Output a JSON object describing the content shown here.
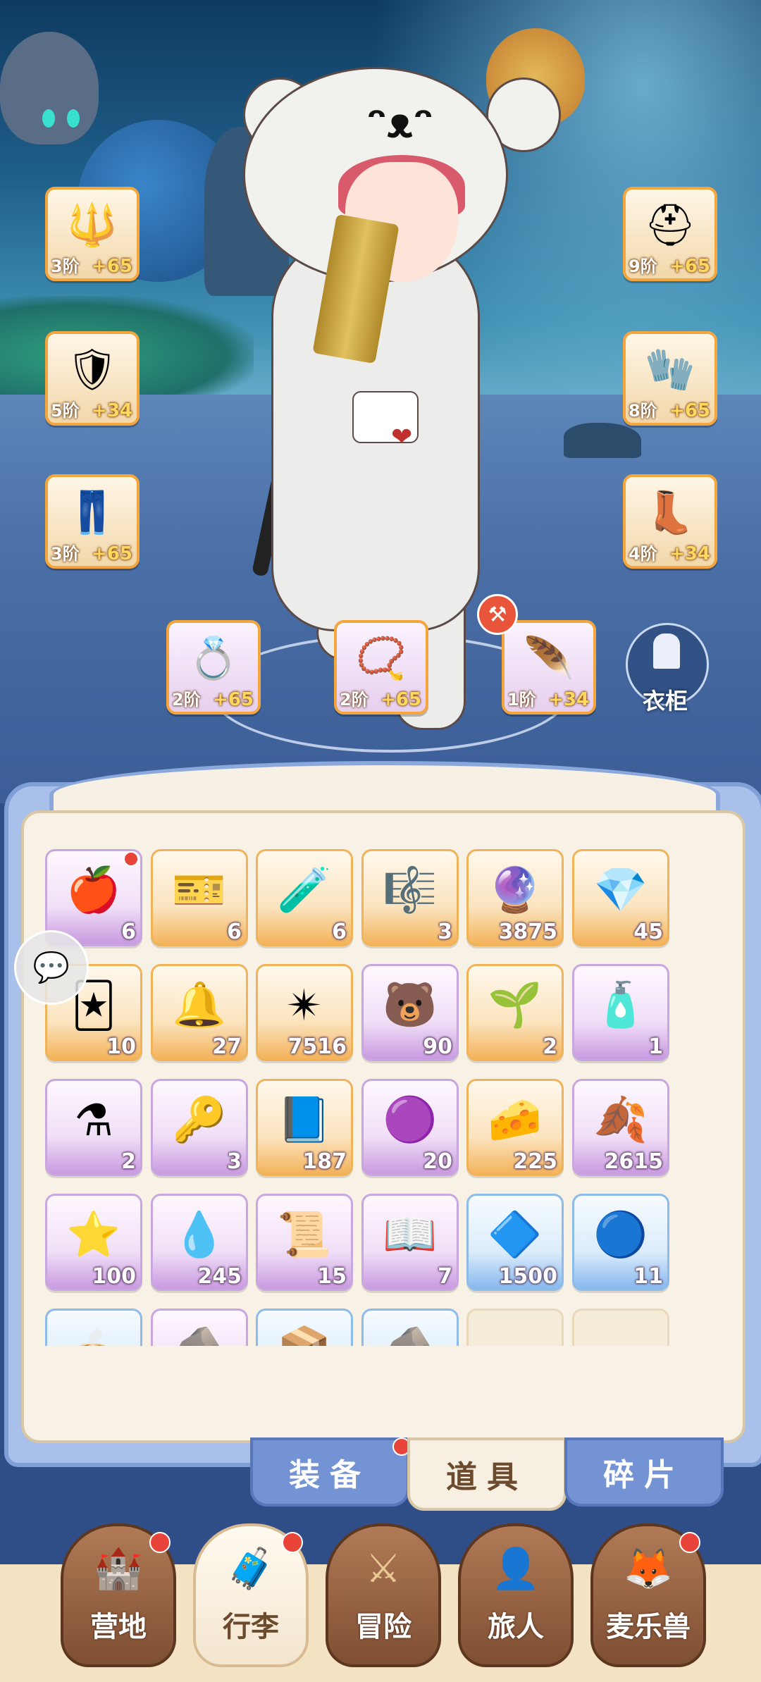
{
  "equipment": {
    "weapon": {
      "icon": "trident-weapon-icon",
      "glyph": "🔱",
      "tier": "3阶",
      "level": "+65"
    },
    "chest": {
      "icon": "armor-chest-icon",
      "glyph": "🛡",
      "tier": "5阶",
      "level": "+34"
    },
    "legs": {
      "icon": "armor-legs-icon",
      "glyph": "👖",
      "tier": "3阶",
      "level": "+65"
    },
    "helmet": {
      "icon": "winged-helmet-icon",
      "glyph": "⛑",
      "tier": "9阶",
      "level": "+65"
    },
    "gloves": {
      "icon": "gauntlet-icon",
      "glyph": "🧤",
      "tier": "8阶",
      "level": "+65"
    },
    "boots": {
      "icon": "boots-icon",
      "glyph": "👢",
      "tier": "4阶",
      "level": "+34"
    },
    "ring": {
      "icon": "ring-icon",
      "glyph": "💍",
      "tier": "2阶",
      "level": "+65"
    },
    "necklace": {
      "icon": "necklace-icon",
      "glyph": "📿",
      "tier": "2阶",
      "level": "+65"
    },
    "earring": {
      "icon": "earring-icon",
      "glyph": "🪶",
      "tier": "1阶",
      "level": "+34"
    }
  },
  "forge_badge_icon": "hammer-icon",
  "wardrobe": {
    "label": "衣柜",
    "icon": "wardrobe-icon"
  },
  "inventory": {
    "items": [
      {
        "icon": "apple-icon",
        "glyph": "🍎",
        "count": "6",
        "rarity": "purple",
        "new": true
      },
      {
        "icon": "ticket-icon",
        "glyph": "🎫",
        "count": "6",
        "rarity": "orange"
      },
      {
        "icon": "blue-potion-icon",
        "glyph": "🧪",
        "count": "6",
        "rarity": "orange"
      },
      {
        "icon": "lyre-icon",
        "glyph": "🎼",
        "count": "3",
        "rarity": "orange"
      },
      {
        "icon": "crystal-orb-icon",
        "glyph": "🔮",
        "count": "3875",
        "rarity": "orange"
      },
      {
        "icon": "ice-crystal-icon",
        "glyph": "💎",
        "count": "45",
        "rarity": "orange"
      },
      {
        "icon": "outfit-card-icon",
        "glyph": "🃏",
        "count": "10",
        "rarity": "orange"
      },
      {
        "icon": "bell-icon",
        "glyph": "🔔",
        "count": "27",
        "rarity": "orange"
      },
      {
        "icon": "star-crystal-icon",
        "glyph": "✴",
        "count": "7516",
        "rarity": "orange"
      },
      {
        "icon": "bear-badge-icon",
        "glyph": "🐻",
        "count": "90",
        "rarity": "purple"
      },
      {
        "icon": "seed-pod-icon",
        "glyph": "🌱",
        "count": "2",
        "rarity": "orange"
      },
      {
        "icon": "potion-bottle-icon",
        "glyph": "🧴",
        "count": "1",
        "rarity": "purple"
      },
      {
        "icon": "red-potion-icon",
        "glyph": "⚗",
        "count": "2",
        "rarity": "purple"
      },
      {
        "icon": "gold-key-icon",
        "glyph": "🔑",
        "count": "3",
        "rarity": "purple"
      },
      {
        "icon": "blue-card-icon",
        "glyph": "📘",
        "count": "187",
        "rarity": "orange"
      },
      {
        "icon": "cat-frame-purple-icon",
        "glyph": "🟣",
        "count": "20",
        "rarity": "purple"
      },
      {
        "icon": "cheese-icon",
        "glyph": "🧀",
        "count": "225",
        "rarity": "orange"
      },
      {
        "icon": "gold-leaf-icon",
        "glyph": "🍂",
        "count": "2615",
        "rarity": "purple"
      },
      {
        "icon": "star-cookie-icon",
        "glyph": "⭐",
        "count": "100",
        "rarity": "purple"
      },
      {
        "icon": "slime-icon",
        "glyph": "💧",
        "count": "245",
        "rarity": "purple"
      },
      {
        "icon": "scroll-card-icon",
        "glyph": "📜",
        "count": "15",
        "rarity": "purple"
      },
      {
        "icon": "book-icon",
        "glyph": "📖",
        "count": "7",
        "rarity": "purple"
      },
      {
        "icon": "blue-gem-icon",
        "glyph": "🔷",
        "count": "1500",
        "rarity": "blue"
      },
      {
        "icon": "cat-frame-blue-icon",
        "glyph": "🔵",
        "count": "11",
        "rarity": "blue"
      },
      {
        "icon": "partial-item-icon",
        "glyph": "🥧",
        "count": "",
        "rarity": "blue"
      },
      {
        "icon": "partial-item-icon",
        "glyph": "🪨",
        "count": "",
        "rarity": "purple"
      },
      {
        "icon": "partial-item-icon",
        "glyph": "📦",
        "count": "",
        "rarity": "blue"
      },
      {
        "icon": "partial-item-icon",
        "glyph": "🪨",
        "count": "",
        "rarity": "blue"
      },
      {
        "icon": "",
        "glyph": "",
        "count": "",
        "rarity": "empty"
      },
      {
        "icon": "",
        "glyph": "",
        "count": "",
        "rarity": "empty"
      }
    ]
  },
  "chat_icon": "chat-bubble-icon",
  "subtabs": [
    {
      "label": "装备",
      "active": false,
      "badge": true
    },
    {
      "label": "道具",
      "active": true,
      "badge": false
    },
    {
      "label": "碎片",
      "active": false,
      "badge": false
    }
  ],
  "nav": [
    {
      "label": "营地",
      "icon": "castle-icon",
      "glyph": "🏰",
      "badge": true,
      "active": false
    },
    {
      "label": "行李",
      "icon": "luggage-icon",
      "glyph": "🧳",
      "badge": true,
      "active": true
    },
    {
      "label": "冒险",
      "icon": "crossed-swords-icon",
      "glyph": "⚔",
      "badge": false,
      "active": false
    },
    {
      "label": "旅人",
      "icon": "traveler-icon",
      "glyph": "👤",
      "badge": false,
      "active": false
    },
    {
      "label": "麦乐兽",
      "icon": "pet-fox-icon",
      "glyph": "🦊",
      "badge": true,
      "active": false
    }
  ],
  "colors": {
    "accent_orange": "#f4a63d",
    "badge_red": "#e8443a",
    "tab_blue": "#7393d4"
  }
}
